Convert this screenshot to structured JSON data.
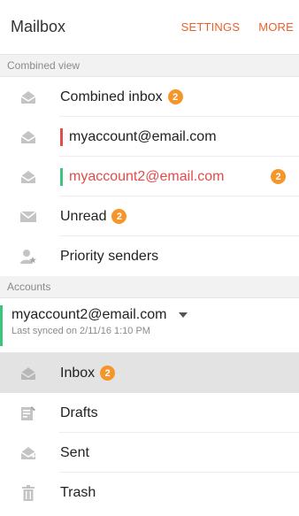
{
  "header": {
    "title": "Mailbox",
    "settings": "SETTINGS",
    "more": "MORE"
  },
  "combined": {
    "section_label": "Combined view",
    "items": [
      {
        "label": "Combined inbox",
        "badge": "2"
      },
      {
        "label": "myaccount@email.com"
      },
      {
        "label": "myaccount2@email.com",
        "badge": "2"
      },
      {
        "label": "Unread",
        "badge": "2"
      },
      {
        "label": "Priority senders"
      }
    ]
  },
  "accounts": {
    "section_label": "Accounts",
    "current": {
      "name": "myaccount2@email.com",
      "synced": "Last synced on 2/11/16 1:10 PM"
    },
    "folders": [
      {
        "label": "Inbox",
        "badge": "2"
      },
      {
        "label": "Drafts"
      },
      {
        "label": "Sent"
      },
      {
        "label": "Trash"
      }
    ]
  },
  "colors": {
    "accent": "#e8622e",
    "badge": "#f5962b",
    "account1": "#e54b4b",
    "account2": "#3cc47c",
    "icon": "#b5b5b5"
  },
  "icons": [
    "inbox-icon",
    "envelope-icon",
    "priority-sender-icon",
    "drafts-icon",
    "sent-icon",
    "trash-icon",
    "dropdown-arrow-icon"
  ]
}
